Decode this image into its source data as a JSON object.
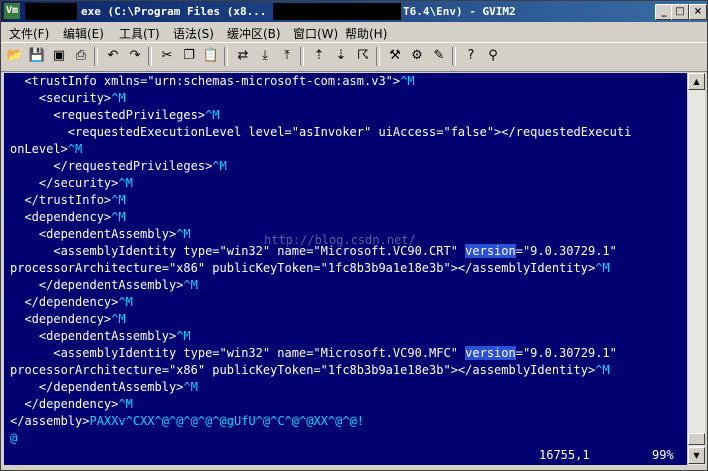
{
  "titlebar": {
    "icon_text": "Vm",
    "title_part1": "exe (C:\\Program Files (x8...",
    "title_part2": "T6.4\\Env) - GVIM2",
    "min": "_",
    "max": "□",
    "close": "×"
  },
  "menu": [
    {
      "label": "文件(F)"
    },
    {
      "label": "编辑(E)"
    },
    {
      "label": "工具(T)"
    },
    {
      "label": "语法(S)"
    },
    {
      "label": "缓冲区(B)"
    },
    {
      "label": "窗口(W)"
    },
    {
      "label": "帮助(H)"
    }
  ],
  "toolbar_icons": [
    "open-icon",
    "save-icon",
    "save-all-icon",
    "print-icon",
    "undo-icon",
    "redo-icon",
    "cut-icon",
    "copy-icon",
    "paste-icon",
    "find-replace-icon",
    "find-next-icon",
    "find-prev-icon",
    "load-session-icon",
    "save-session-icon",
    "run-script-icon",
    "make-icon",
    "shell-icon",
    "ctags-icon",
    "help-icon",
    "find-help-icon"
  ],
  "editor": {
    "lines": [
      {
        "text": "  <trustInfo xmlns=\"urn:schemas-microsoft-com:asm.v3\">",
        "ctl": "^M"
      },
      {
        "text": "    <security>",
        "ctl": "^M"
      },
      {
        "text": "      <requestedPrivileges>",
        "ctl": "^M"
      },
      {
        "text": "        <requestedExecutionLevel level=\"asInvoker\" uiAccess=\"false\"></requestedExecuti",
        "ctl": ""
      },
      {
        "text": "onLevel>",
        "ctl": "^M"
      },
      {
        "text": "      </requestedPrivileges>",
        "ctl": "^M"
      },
      {
        "text": "    </security>",
        "ctl": "^M"
      },
      {
        "text": "  </trustInfo>",
        "ctl": "^M"
      },
      {
        "text": "  <dependency>",
        "ctl": "^M"
      },
      {
        "text": "    <dependentAssembly>",
        "ctl": "^M"
      },
      {
        "pre": "      <assemblyIdentity type=\"win32\" name=\"Microsoft.VC90.CRT\" ",
        "hl": "version",
        "post": "=\"9.0.30729.1\"",
        "ctl": ""
      },
      {
        "text": "processorArchitecture=\"x86\" publicKeyToken=\"1fc8b3b9a1e18e3b\"></assemblyIdentity>",
        "ctl": "^M"
      },
      {
        "text": "    </dependentAssembly>",
        "ctl": "^M"
      },
      {
        "text": "  </dependency>",
        "ctl": "^M"
      },
      {
        "text": "  <dependency>",
        "ctl": "^M"
      },
      {
        "text": "    <dependentAssembly>",
        "ctl": "^M"
      },
      {
        "pre": "      <assemblyIdentity type=\"win32\" name=\"Microsoft.VC90.MFC\" ",
        "hl": "version",
        "post": "=\"9.0.30729.1\"",
        "ctl": ""
      },
      {
        "text": "processorArchitecture=\"x86\" publicKeyToken=\"1fc8b3b9a1e18e3b\"></assemblyIdentity>",
        "ctl": "^M"
      },
      {
        "text": "    </dependentAssembly>",
        "ctl": "^M"
      },
      {
        "text": "  </dependency>",
        "ctl": "^M"
      },
      {
        "text": "</assembly>",
        "ctl": "PAXXv^CXX^@^@^@^@^@gUfU^@^C^@^@XX^@^@!"
      },
      {
        "text": "",
        "ctl": "@"
      }
    ],
    "watermark": "http://blog.csdn.net/"
  },
  "status": {
    "position": "16755,1",
    "percent": "99%"
  }
}
